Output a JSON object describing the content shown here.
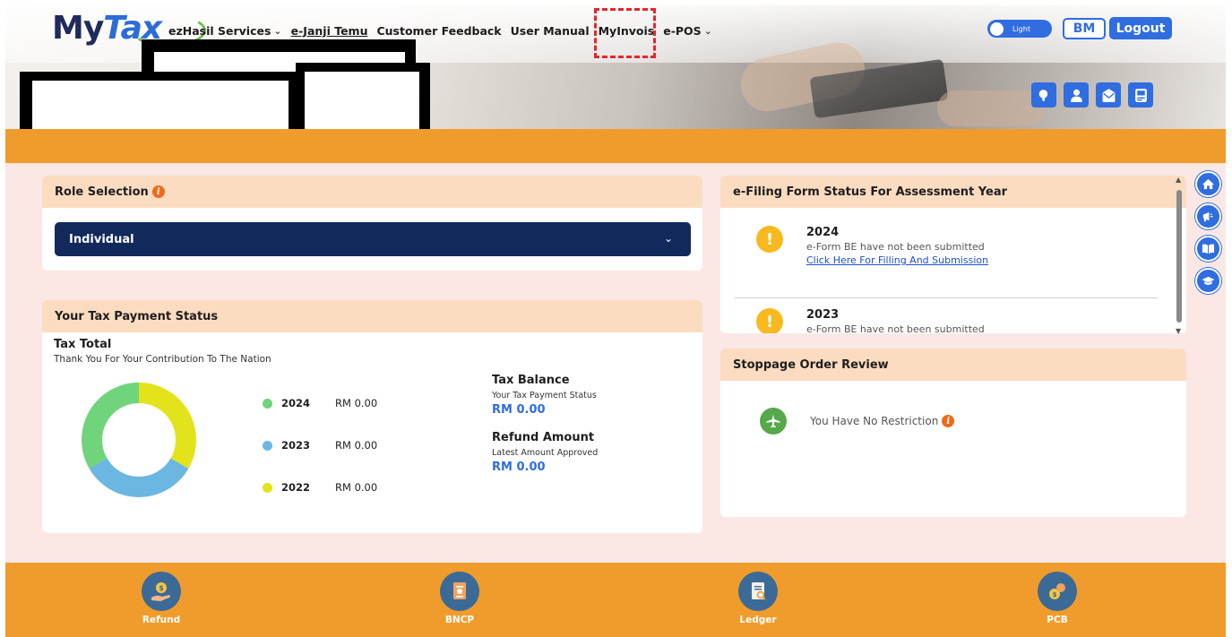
{
  "header": {
    "logo": {
      "text_my": "My",
      "text_tax": "Tax"
    },
    "nav": [
      {
        "label": "ezHasil Services",
        "has_dropdown": true
      },
      {
        "label": "e-Janji Temu",
        "has_dropdown": false
      },
      {
        "label": "Customer Feedback",
        "has_dropdown": false
      },
      {
        "label": "User Manual",
        "has_dropdown": false
      },
      {
        "label": "MyInvois",
        "has_dropdown": false,
        "highlighted": true
      },
      {
        "label": "e-POS",
        "has_dropdown": true
      }
    ],
    "theme_toggle": {
      "label": "Light"
    },
    "language_button": "BM",
    "logout_button": "Logout",
    "quick_icons": [
      "search-icon",
      "profile-icon",
      "mail-icon",
      "device-icon"
    ]
  },
  "role_selection": {
    "title": "Role Selection",
    "selected": "Individual"
  },
  "tax_payment": {
    "title": "Your Tax Payment Status",
    "total_title": "Tax Total",
    "total_subtitle": "Thank You For Your Contribution To The Nation",
    "legend": [
      {
        "year": "2024",
        "amount": "RM 0.00",
        "color": "#6fd47c"
      },
      {
        "year": "2023",
        "amount": "RM 0.00",
        "color": "#6bb7e1"
      },
      {
        "year": "2022",
        "amount": "RM 0.00",
        "color": "#e3e31b"
      }
    ],
    "balance": {
      "title": "Tax Balance",
      "subtitle": "Your Tax Payment Status",
      "value": "RM 0.00"
    },
    "refund": {
      "title": "Refund Amount",
      "subtitle": "Latest Amount Approved",
      "value": "RM 0.00"
    }
  },
  "efiling": {
    "title": "e-Filing Form Status For Assessment Year",
    "items": [
      {
        "year": "2024",
        "message": "e-Form BE have not been submitted",
        "link": "Click Here For Filling And Submission"
      },
      {
        "year": "2023",
        "message": "e-Form BE have not been submitted"
      }
    ]
  },
  "stoppage": {
    "title": "Stoppage Order Review",
    "message": "You Have No Restriction"
  },
  "side_icons": [
    "home-icon",
    "megaphone-icon",
    "book-icon",
    "graduation-cap-icon"
  ],
  "footer": [
    {
      "label": "Refund",
      "icon": "refund-icon"
    },
    {
      "label": "BNCP",
      "icon": "bncp-icon"
    },
    {
      "label": "Ledger",
      "icon": "ledger-icon"
    },
    {
      "label": "PCB",
      "icon": "pcb-icon"
    }
  ],
  "colors": {
    "accent": "#2f6de1",
    "orange": "#f09c2c",
    "navy": "#12295c",
    "card_header": "#fcdcc0",
    "panel_bg": "#fbe8e4"
  }
}
